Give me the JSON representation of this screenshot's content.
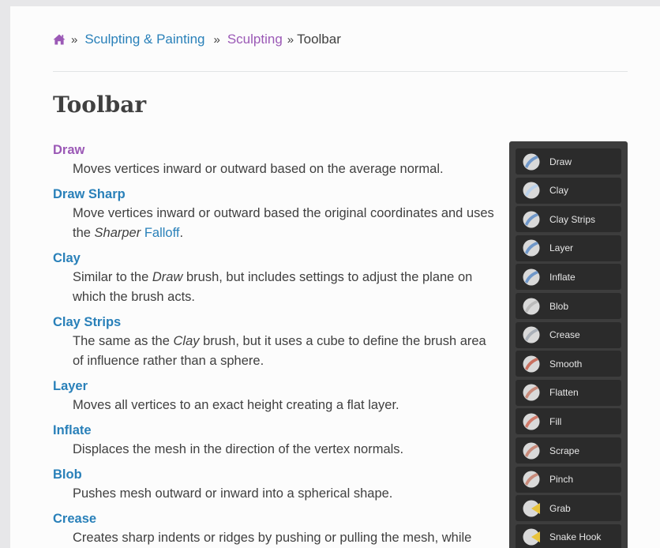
{
  "breadcrumb": {
    "home_icon": "home-icon",
    "separator": "»",
    "items": [
      "Sculpting & Painting",
      "Sculpting"
    ],
    "current": "Toolbar"
  },
  "page": {
    "title": "Toolbar"
  },
  "tools": [
    {
      "name": "Draw",
      "desc": "Moves vertices inward or outward based on the average normal."
    },
    {
      "name": "Draw Sharp",
      "desc": {
        "before": "Move vertices inward or outward based the original coordinates and uses the ",
        "em": "Sharper",
        "link": "Falloff",
        "after": "."
      }
    },
    {
      "name": "Clay",
      "desc": {
        "before": "Similar to the ",
        "em": "Draw",
        "after": " brush, but includes settings to adjust the plane on which the brush acts."
      }
    },
    {
      "name": "Clay Strips",
      "desc": {
        "before": "The same as the ",
        "em": "Clay",
        "after": " brush, but it uses a cube to define the brush area of influence rather than a sphere."
      }
    },
    {
      "name": "Layer",
      "desc": "Moves all vertices to an exact height creating a flat layer."
    },
    {
      "name": "Inflate",
      "desc": "Displaces the mesh in the direction of the vertex normals."
    },
    {
      "name": "Blob",
      "desc": "Pushes mesh outward or inward into a spherical shape."
    },
    {
      "name": "Crease",
      "desc": "Creates sharp indents or ridges by pushing or pulling the mesh, while"
    }
  ],
  "toolbar_panel": {
    "items": [
      {
        "label": "Draw",
        "icon": "draw-brush-icon"
      },
      {
        "label": "Clay",
        "icon": "clay-brush-icon"
      },
      {
        "label": "Clay Strips",
        "icon": "clay-strips-brush-icon"
      },
      {
        "label": "Layer",
        "icon": "layer-brush-icon"
      },
      {
        "label": "Inflate",
        "icon": "inflate-brush-icon"
      },
      {
        "label": "Blob",
        "icon": "blob-brush-icon"
      },
      {
        "label": "Crease",
        "icon": "crease-brush-icon"
      },
      {
        "label": "Smooth",
        "icon": "smooth-brush-icon"
      },
      {
        "label": "Flatten",
        "icon": "flatten-brush-icon"
      },
      {
        "label": "Fill",
        "icon": "fill-brush-icon"
      },
      {
        "label": "Scrape",
        "icon": "scrape-brush-icon"
      },
      {
        "label": "Pinch",
        "icon": "pinch-brush-icon"
      },
      {
        "label": "Grab",
        "icon": "grab-brush-icon"
      },
      {
        "label": "Snake Hook",
        "icon": "snake-hook-brush-icon"
      }
    ]
  },
  "colors": {
    "link": "#2980b9",
    "visited_link": "#9b59b6",
    "text": "#404040",
    "panel_bg": "#3d3d3d",
    "panel_item_bg": "#2b2b2b",
    "icon_accent_blue": "#6f97c9",
    "icon_accent_yellow": "#e8c33c"
  }
}
